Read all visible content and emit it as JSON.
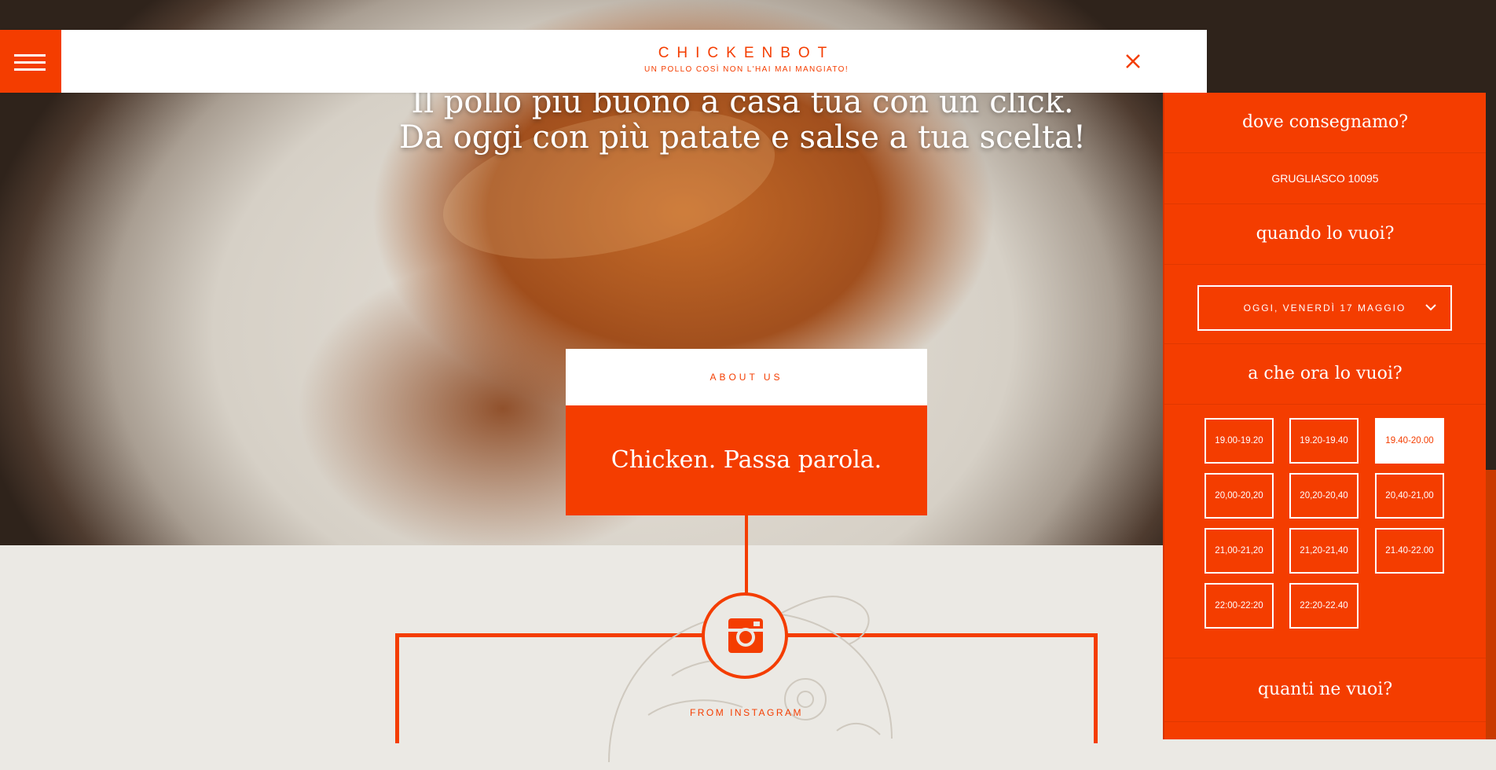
{
  "header": {
    "brand": "CHICKENBOT",
    "tagline": "UN POLLO COSÌ NON L'HAI MAI MANGIATO!"
  },
  "hero": {
    "line1": "Il pollo più buono a casa tua con un click.",
    "line2": "Da oggi con più patate e salse a tua scelta!"
  },
  "about": {
    "label": "ABOUT US",
    "title": "Chicken. Passa parola."
  },
  "instagram": {
    "label": "FROM INSTAGRAM"
  },
  "order_panel": {
    "where_heading": "dove consegnamo?",
    "location": "GRUGLIASCO 10095",
    "when_heading": "quando lo vuoi?",
    "date_selected": "OGGI, VENERDÌ 17 MAGGIO",
    "time_heading": "a che ora lo vuoi?",
    "slots": [
      "19.00-19.20",
      "19.20-19.40",
      "19.40-20.00",
      "20,00-20,20",
      "20,20-20,40",
      "20,40-21,00",
      "21,00-21,20",
      "21,20-21,40",
      "21.40-22.00",
      "22:00-22:20",
      "22:20-22.40"
    ],
    "selected_slot": "19.40-20.00",
    "quantity_heading": "quanti ne vuoi?"
  },
  "colors": {
    "brand": "#f43d00",
    "background": "#ebe9e4"
  }
}
